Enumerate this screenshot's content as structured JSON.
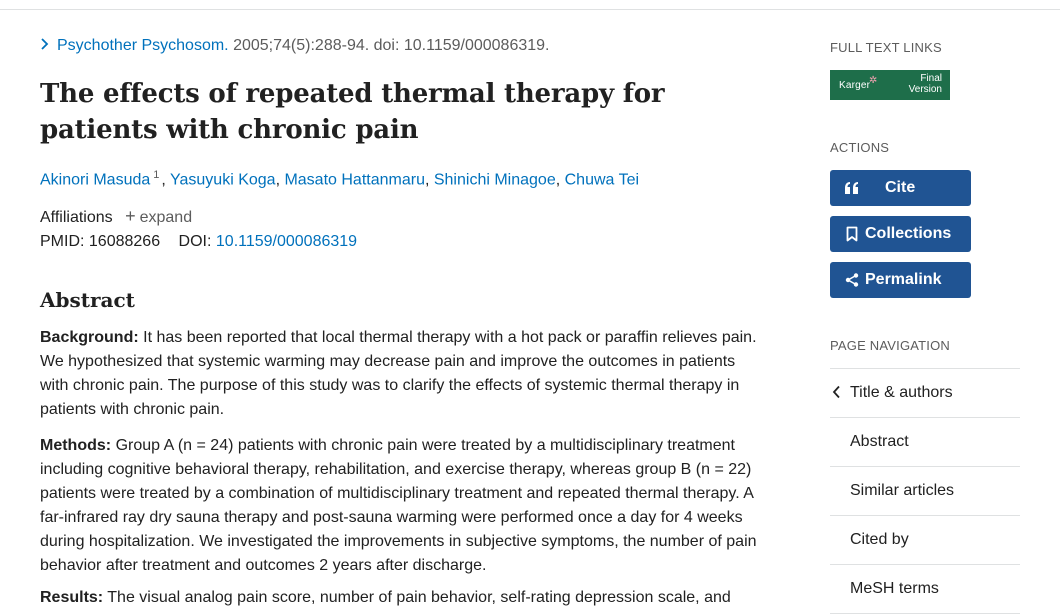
{
  "citation": {
    "journal": "Psychother Psychosom.",
    "details": "2005;74(5):288-94. doi: 10.1159/000086319."
  },
  "title": "The effects of repeated thermal therapy for patients with chronic pain",
  "authors": [
    {
      "name": "Akinori Masuda",
      "sup": "1"
    },
    {
      "name": "Yasuyuki Koga"
    },
    {
      "name": "Masato Hattanmaru"
    },
    {
      "name": "Shinichi Minagoe"
    },
    {
      "name": "Chuwa Tei"
    }
  ],
  "affiliations": {
    "label": "Affiliations",
    "expand": "expand"
  },
  "ids": {
    "pmid_label": "PMID:",
    "pmid": "16088266",
    "doi_label": "DOI:",
    "doi": "10.1159/000086319"
  },
  "abstract": {
    "heading": "Abstract",
    "background_label": "Background:",
    "background": "It has been reported that local thermal therapy with a hot pack or paraffin relieves pain. We hypothesized that systemic warming may decrease pain and improve the outcomes in patients with chronic pain. The purpose of this study was to clarify the effects of systemic thermal therapy in patients with chronic pain.",
    "methods_label": "Methods:",
    "methods": "Group A (n = 24) patients with chronic pain were treated by a multidisciplinary treatment including cognitive behavioral therapy, rehabilitation, and exercise therapy, whereas group B (n = 22) patients were treated by a combination of multidisciplinary treatment and repeated thermal therapy. A far-infrared ray dry sauna therapy and post-sauna warming were performed once a day for 4 weeks during hospitalization. We investigated the improvements in subjective symptoms, the number of pain behavior after treatment and outcomes 2 years after discharge.",
    "results_label": "Results:",
    "results": "The visual analog pain score, number of pain behavior, self-rating depression scale, and"
  },
  "sidebar": {
    "full_text_heading": "FULL TEXT LINKS",
    "karger_logo": "Karger",
    "karger_final": "Final",
    "karger_version": "Version",
    "actions_heading": "ACTIONS",
    "cite": "Cite",
    "collections": "Collections",
    "permalink": "Permalink",
    "page_nav_heading": "PAGE NAVIGATION",
    "nav": [
      "Title & authors",
      "Abstract",
      "Similar articles",
      "Cited by",
      "MeSH terms"
    ]
  },
  "colors": {
    "link": "#0071bc",
    "button": "#205493",
    "karger": "#1e6e4a"
  }
}
